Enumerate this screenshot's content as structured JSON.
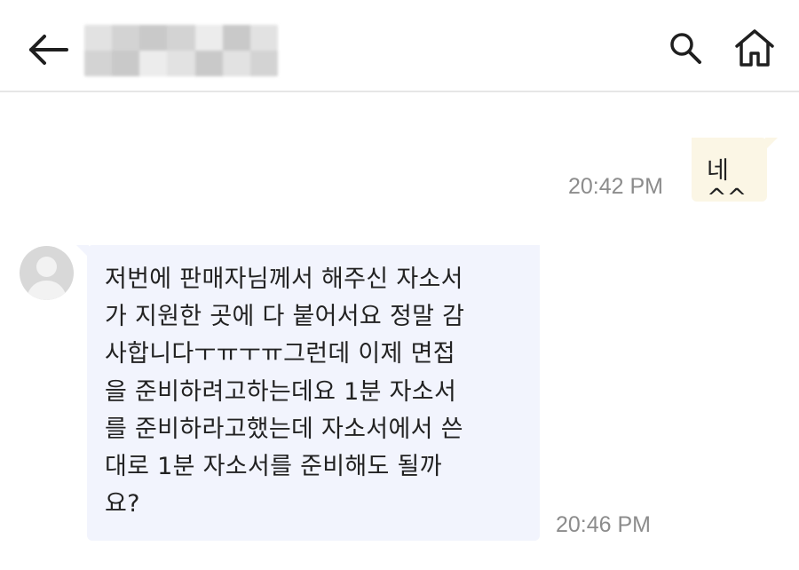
{
  "header": {
    "back_icon": "arrow-left-icon",
    "contact_name_redacted": true,
    "search_icon": "search-icon",
    "home_icon": "home-icon"
  },
  "messages": [
    {
      "direction": "outgoing",
      "text": "네^^",
      "time": "20:42 PM"
    },
    {
      "direction": "incoming",
      "text": "저번에 판매자님께서 해주신 자소서\n가 지원한 곳에 다 붙어서요 정말 감\n사합니다ㅜㅠㅜㅠ그런데 이제 면접\n을 준비하려고하는데요 1분 자소서\n를 준비하라고했는데 자소서에서 쓴\n대로 1분 자소서를 준비해도 될까\n요?",
      "time": "20:46 PM"
    }
  ],
  "colors": {
    "outgoing_bubble": "#fbf6e5",
    "incoming_bubble": "#f2f4fd",
    "timestamp": "#8c8c8c",
    "divider": "#e6e6e6"
  }
}
